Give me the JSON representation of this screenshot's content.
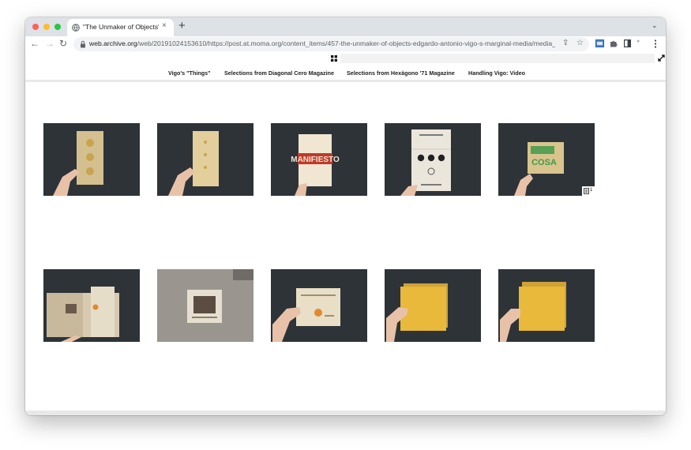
{
  "browser": {
    "tab_title": "\"The Unmaker of Objects\": Ed",
    "url_host": "web.archive.org",
    "url_path": "/web/20191024153610/https://post.at.moma.org/content_items/457-the-unmaker-of-objects-edgardo-antonio-vigo-s-marginal-media/media_...",
    "new_tab_label": "+",
    "close_label": "×",
    "tab_menu_label": "⌄"
  },
  "nav": {
    "links": [
      "Vigo's \"Things\"",
      "Selections from Diagonal Cero Magazine",
      "Selections from Hexágono '71 Magazine",
      "Handling Vigo: Video"
    ]
  },
  "gallery": {
    "items": [
      {
        "subject": "beige booklet with three round cut-outs"
      },
      {
        "subject": "beige booklet with three small dots"
      },
      {
        "subject": "booklet with red MANIFIESTO lettering",
        "text": "MANIFIESTO"
      },
      {
        "subject": "unfolded sheet with black circles"
      },
      {
        "subject": "green stamped booklet",
        "text": "COSA",
        "badge_count": "1"
      },
      {
        "subject": "folded card with slide"
      },
      {
        "subject": "mounted slide on grey card"
      },
      {
        "subject": "card with orange round stamp"
      },
      {
        "subject": "stack of yellow sheets"
      },
      {
        "subject": "stack of yellow sheets"
      }
    ]
  },
  "colors": {
    "tabstrip": "#dee1e6",
    "photo_background": "#2e3338",
    "manifiesto_red": "#c0392b",
    "cosa_green": "#3f9a4a",
    "yellow_sheet": "#e8b93a"
  }
}
